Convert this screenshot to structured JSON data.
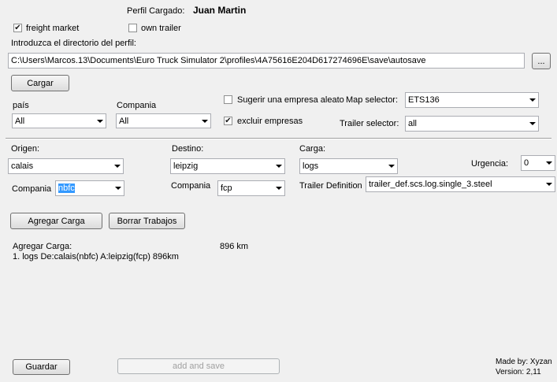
{
  "profile": {
    "label": "Perfil Cargado:",
    "name": "Juan Martin"
  },
  "options": {
    "freight_market": "freight market",
    "own_trailer": "own trailer"
  },
  "directory": {
    "label": "Introduzca el directorio del perfil:",
    "value": "C:\\Users\\Marcos.13\\Documents\\Euro Truck Simulator 2\\profiles\\4A75616E204D617274696E\\save\\autosave",
    "browse_label": "..."
  },
  "load_button": "Cargar",
  "filters": {
    "pais_label": "país",
    "pais_value": "All",
    "compania_label": "Compania",
    "compania_value": "All",
    "suggest_label": "Sugerir una empresa aleatori",
    "exclude_label": "excluir empresas",
    "map_selector_label": "Map selector:",
    "map_selector_value": "ETS136",
    "trailer_selector_label": "Trailer selector:",
    "trailer_selector_value": "all"
  },
  "origin": {
    "label": "Origen:",
    "city": "calais",
    "company_label": "Compania",
    "company": "nbfc"
  },
  "destination": {
    "label": "Destino:",
    "city": "leipzig",
    "company_label": "Compania",
    "company": "fcp"
  },
  "cargo": {
    "label": "Carga:",
    "value": "logs",
    "trailer_def_label": "Trailer Definition",
    "trailer_def_value": "trailer_def.scs.log.single_3.steel"
  },
  "urgency": {
    "label": "Urgencia:",
    "value": "0"
  },
  "buttons": {
    "add_cargo": "Agregar Carga",
    "clear_jobs": "Borrar Trabajos",
    "save": "Guardar",
    "add_and_save": "add and save"
  },
  "job_list": {
    "title": "Agregar Carga:",
    "distance": "896 km",
    "items": [
      "1. logs De:calais(nbfc) A:leipzig(fcp) 896km"
    ]
  },
  "footer": {
    "made_by": "Made by: Xyzan",
    "version": "Version: 2,11"
  }
}
